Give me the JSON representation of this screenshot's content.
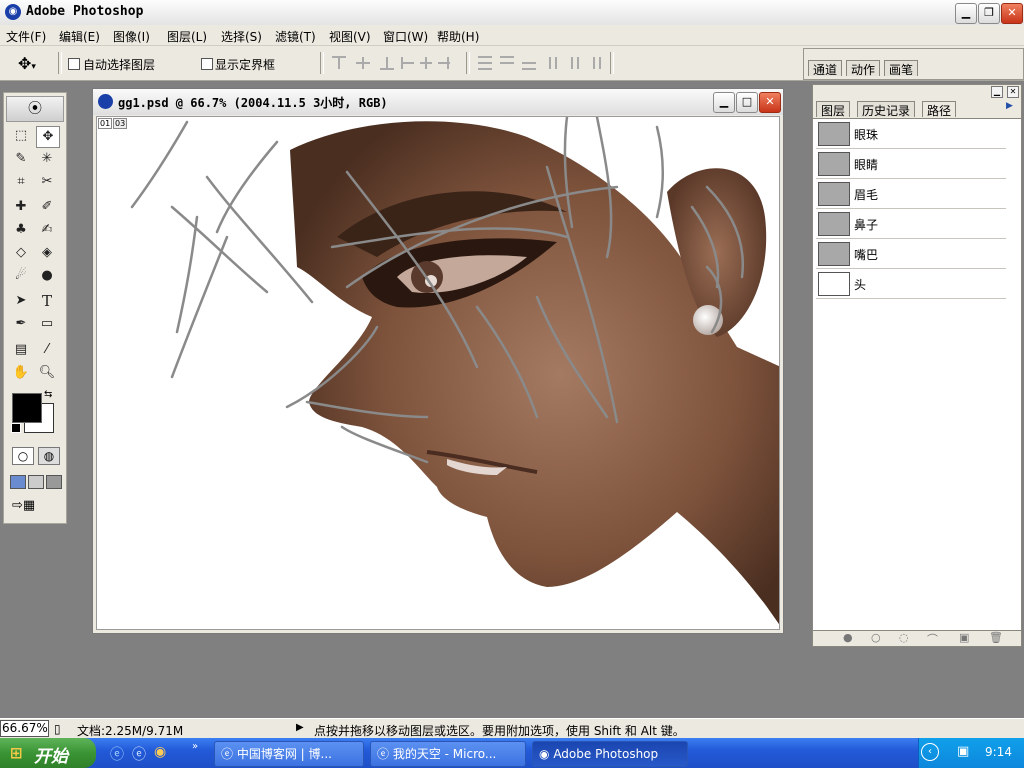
{
  "app": {
    "title": "Adobe Photoshop"
  },
  "menu": [
    "文件(F)",
    "编辑(E)",
    "图像(I)",
    "图层(L)",
    "选择(S)",
    "滤镜(T)",
    "视图(V)",
    "窗口(W)",
    "帮助(H)"
  ],
  "options": {
    "auto_select_label": "自动选择图层",
    "show_bounds_label": "显示定界框"
  },
  "brush_panel": {
    "tabs": [
      "通道",
      "动作",
      "画笔"
    ]
  },
  "path_panel": {
    "tabs": [
      "图层",
      "历史记录",
      "路径"
    ],
    "active_tab": "路径",
    "paths": [
      "眼珠",
      "眼睛",
      "眉毛",
      "鼻子",
      "嘴巴",
      "头"
    ]
  },
  "document": {
    "title": "gg1.psd @ 66.7% (2004.11.5 3小时, RGB)",
    "ruler_labels": [
      "01",
      "03"
    ]
  },
  "status": {
    "zoom": "66.67%",
    "doc_size": "文档:2.25M/9.71M",
    "hint": "点按并拖移以移动图层或选区。要用附加选项，使用 Shift 和 Alt 键。"
  },
  "taskbar": {
    "start_label": "开始",
    "tasks": [
      "中国博客网 | 博...",
      "我的天空 - Micro...",
      "Adobe Photoshop"
    ],
    "active_task": "Adobe Photoshop",
    "clock": "9:14"
  },
  "colors": {
    "foreground": "#000000",
    "background": "#ffffff",
    "skin": "#8a5a42"
  }
}
